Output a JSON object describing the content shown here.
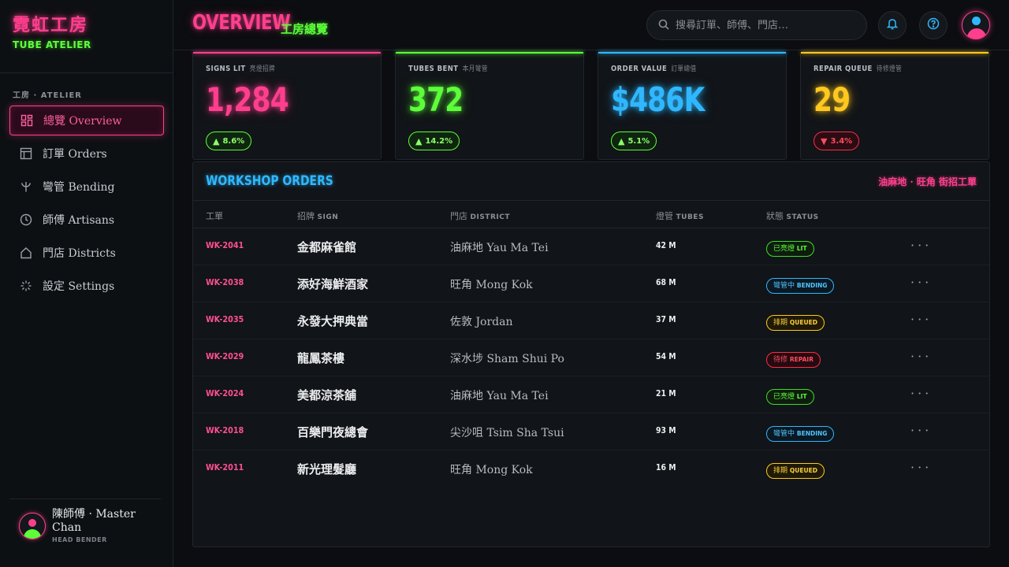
{
  "brand": {
    "name_cn": "霓虹工房",
    "name_en": "TUBE ATELIER"
  },
  "sidebar": {
    "section_label": "工房 · ATELIER",
    "items": [
      {
        "label": "總覽 Overview",
        "icon": "dashboard-icon",
        "active": true
      },
      {
        "label": "訂單 Orders",
        "icon": "orders-icon",
        "active": false
      },
      {
        "label": "彎管 Bending",
        "icon": "bending-icon",
        "active": false
      },
      {
        "label": "師傅 Artisans",
        "icon": "clock-icon",
        "active": false
      },
      {
        "label": "門店 Districts",
        "icon": "home-icon",
        "active": false
      },
      {
        "label": "設定 Settings",
        "icon": "settings-icon",
        "active": false
      }
    ],
    "user": {
      "name": "陳師傅 · Master Chan",
      "role": "HEAD BENDER"
    }
  },
  "header": {
    "title": "OVERVIEW",
    "subtitle": "工房總覽",
    "search_placeholder": "搜尋訂單、師傅、門店…"
  },
  "colors": {
    "pink": "#ff3f8e",
    "green": "#5cff3a",
    "blue": "#2fb8ff",
    "yellow": "#ffc81f",
    "red": "#ff2a4a"
  },
  "kpis": [
    {
      "label": "SIGNS LIT",
      "label_cn": "亮燈招牌",
      "value": "1,284",
      "change": "8.6%",
      "direction": "up",
      "color": "#ff3f8e"
    },
    {
      "label": "TUBES BENT",
      "label_cn": "本月彎管",
      "value": "372",
      "change": "14.2%",
      "direction": "up",
      "color": "#5cff3a"
    },
    {
      "label": "ORDER VALUE",
      "label_cn": "訂單總值",
      "value": "$486K",
      "change": "5.1%",
      "direction": "up",
      "color": "#2fb8ff"
    },
    {
      "label": "REPAIR QUEUE",
      "label_cn": "待修燈管",
      "value": "29",
      "change": "3.4%",
      "direction": "down",
      "color": "#ffc81f"
    }
  ],
  "orders": {
    "title": "WORKSHOP ORDERS",
    "note": "油麻地 · 旺角 街招工單",
    "columns": [
      {
        "cn": "工單",
        "en": ""
      },
      {
        "cn": "招牌",
        "en": "SIGN"
      },
      {
        "cn": "門店",
        "en": "DISTRICT"
      },
      {
        "cn": "燈管",
        "en": "TUBES"
      },
      {
        "cn": "狀態",
        "en": "STATUS"
      }
    ],
    "rows": [
      {
        "id": "WK-2041",
        "sign": "金都麻雀館",
        "district": "油麻地 Yau Ma Tei",
        "tubes": "42 M",
        "status_cn": "已亮燈",
        "status_en": "LIT",
        "status": "lit"
      },
      {
        "id": "WK-2038",
        "sign": "添好海鮮酒家",
        "district": "旺角 Mong Kok",
        "tubes": "68 M",
        "status_cn": "彎管中",
        "status_en": "BENDING",
        "status": "bend"
      },
      {
        "id": "WK-2035",
        "sign": "永發大押典當",
        "district": "佐敦 Jordan",
        "tubes": "37 M",
        "status_cn": "排期",
        "status_en": "QUEUED",
        "status": "queue"
      },
      {
        "id": "WK-2029",
        "sign": "龍鳳茶樓",
        "district": "深水埗 Sham Shui Po",
        "tubes": "54 M",
        "status_cn": "待修",
        "status_en": "REPAIR",
        "status": "repair"
      },
      {
        "id": "WK-2024",
        "sign": "美都涼茶舖",
        "district": "油麻地 Yau Ma Tei",
        "tubes": "21 M",
        "status_cn": "已亮燈",
        "status_en": "LIT",
        "status": "lit"
      },
      {
        "id": "WK-2018",
        "sign": "百樂門夜總會",
        "district": "尖沙咀 Tsim Sha Tsui",
        "tubes": "93 M",
        "status_cn": "彎管中",
        "status_en": "BENDING",
        "status": "bend"
      },
      {
        "id": "WK-2011",
        "sign": "新光理髮廳",
        "district": "旺角 Mong Kok",
        "tubes": "16 M",
        "status_cn": "排期",
        "status_en": "QUEUED",
        "status": "queue"
      }
    ]
  }
}
